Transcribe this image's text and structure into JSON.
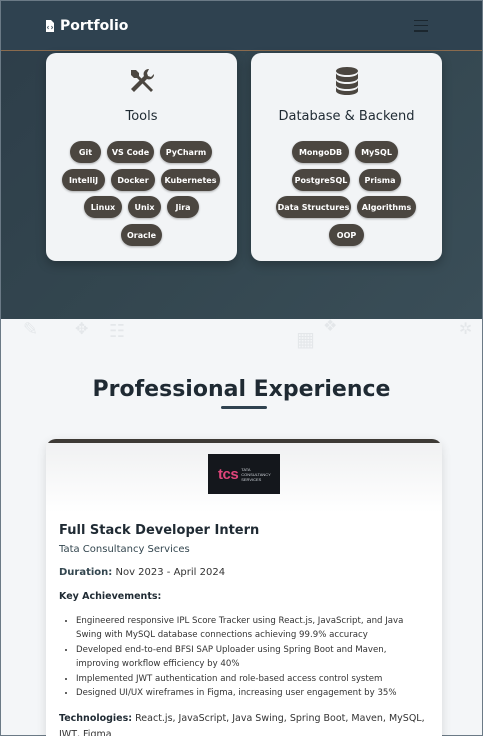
{
  "nav": {
    "brand": "Portfolio"
  },
  "skills": [
    {
      "title": "Tools",
      "icon": "tools-icon",
      "items": [
        "Git",
        "VS Code",
        "PyCharm",
        "IntelliJ",
        "Docker",
        "Kubernetes",
        "Linux",
        "Unix",
        "Jira",
        "Oracle"
      ]
    },
    {
      "title": "Database & Backend",
      "icon": "database-icon",
      "items": [
        "MongoDB",
        "MySQL",
        "PostgreSQL",
        "Prisma",
        "Data Structures",
        "Algorithms",
        "OOP"
      ]
    }
  ],
  "experience_section": {
    "title": "Professional Experience"
  },
  "experience": {
    "logo_text": "tcs",
    "logo_sub": [
      "TATA",
      "CONSULTANCY",
      "SERVICES"
    ],
    "role": "Full Stack Developer Intern",
    "company": "Tata Consultancy Services",
    "duration_label": "Duration:",
    "duration": "Nov 2023 - April 2024",
    "achievements_label": "Key Achievements:",
    "achievements": [
      "Engineered responsive IPL Score Tracker using React.js, JavaScript, and Java Swing with MySQL database connections achieving 99.9% accuracy",
      "Developed end-to-end BFSI SAP Uploader using Spring Boot and Maven, improving workflow efficiency by 40%",
      "Implemented JWT authentication and role-based access control system",
      "Designed UI/UX wireframes in Figma, increasing user engagement by 35%"
    ],
    "technologies_label": "Technologies:",
    "technologies": "React.js, JavaScript, Java Swing, Spring Boot, Maven, MySQL, JWT, Figma"
  },
  "colors": {
    "hero_bg": "#33464f",
    "pill_bg": "#4b4640",
    "logo_accent": "#e0457b"
  }
}
